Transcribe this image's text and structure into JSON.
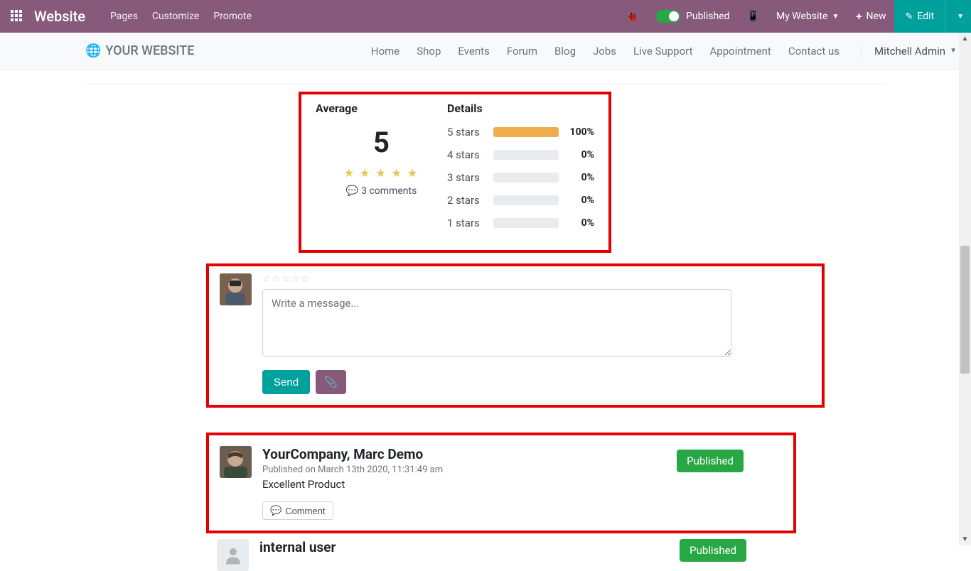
{
  "topbar": {
    "brand": "Website",
    "menu": [
      "Pages",
      "Customize",
      "Promote"
    ],
    "published_label": "Published",
    "my_website": "My Website",
    "new_label": "New",
    "edit_label": "Edit"
  },
  "sitenav": {
    "logo": "YOUR WEBSITE",
    "links": [
      "Home",
      "Shop",
      "Events",
      "Forum",
      "Blog",
      "Jobs",
      "Live Support",
      "Appointment",
      "Contact us"
    ],
    "user": "Mitchell Admin"
  },
  "rating": {
    "average_label": "Average",
    "details_label": "Details",
    "average_value": "5",
    "comments_count": "3 comments",
    "breakdown": [
      {
        "label": "5 stars",
        "pct": "100%",
        "fill": 100
      },
      {
        "label": "4 stars",
        "pct": "0%",
        "fill": 0
      },
      {
        "label": "3 stars",
        "pct": "0%",
        "fill": 0
      },
      {
        "label": "2 stars",
        "pct": "0%",
        "fill": 0
      },
      {
        "label": "1 stars",
        "pct": "0%",
        "fill": 0
      }
    ]
  },
  "compose": {
    "placeholder": "Write a message...",
    "send_label": "Send"
  },
  "comments": [
    {
      "author": "YourCompany, Marc Demo",
      "meta": "Published on March 13th 2020, 11:31:49 am",
      "text": "Excellent Product",
      "badge": "Published",
      "comment_btn": "Comment"
    },
    {
      "author": "internal user",
      "badge": "Published"
    }
  ]
}
